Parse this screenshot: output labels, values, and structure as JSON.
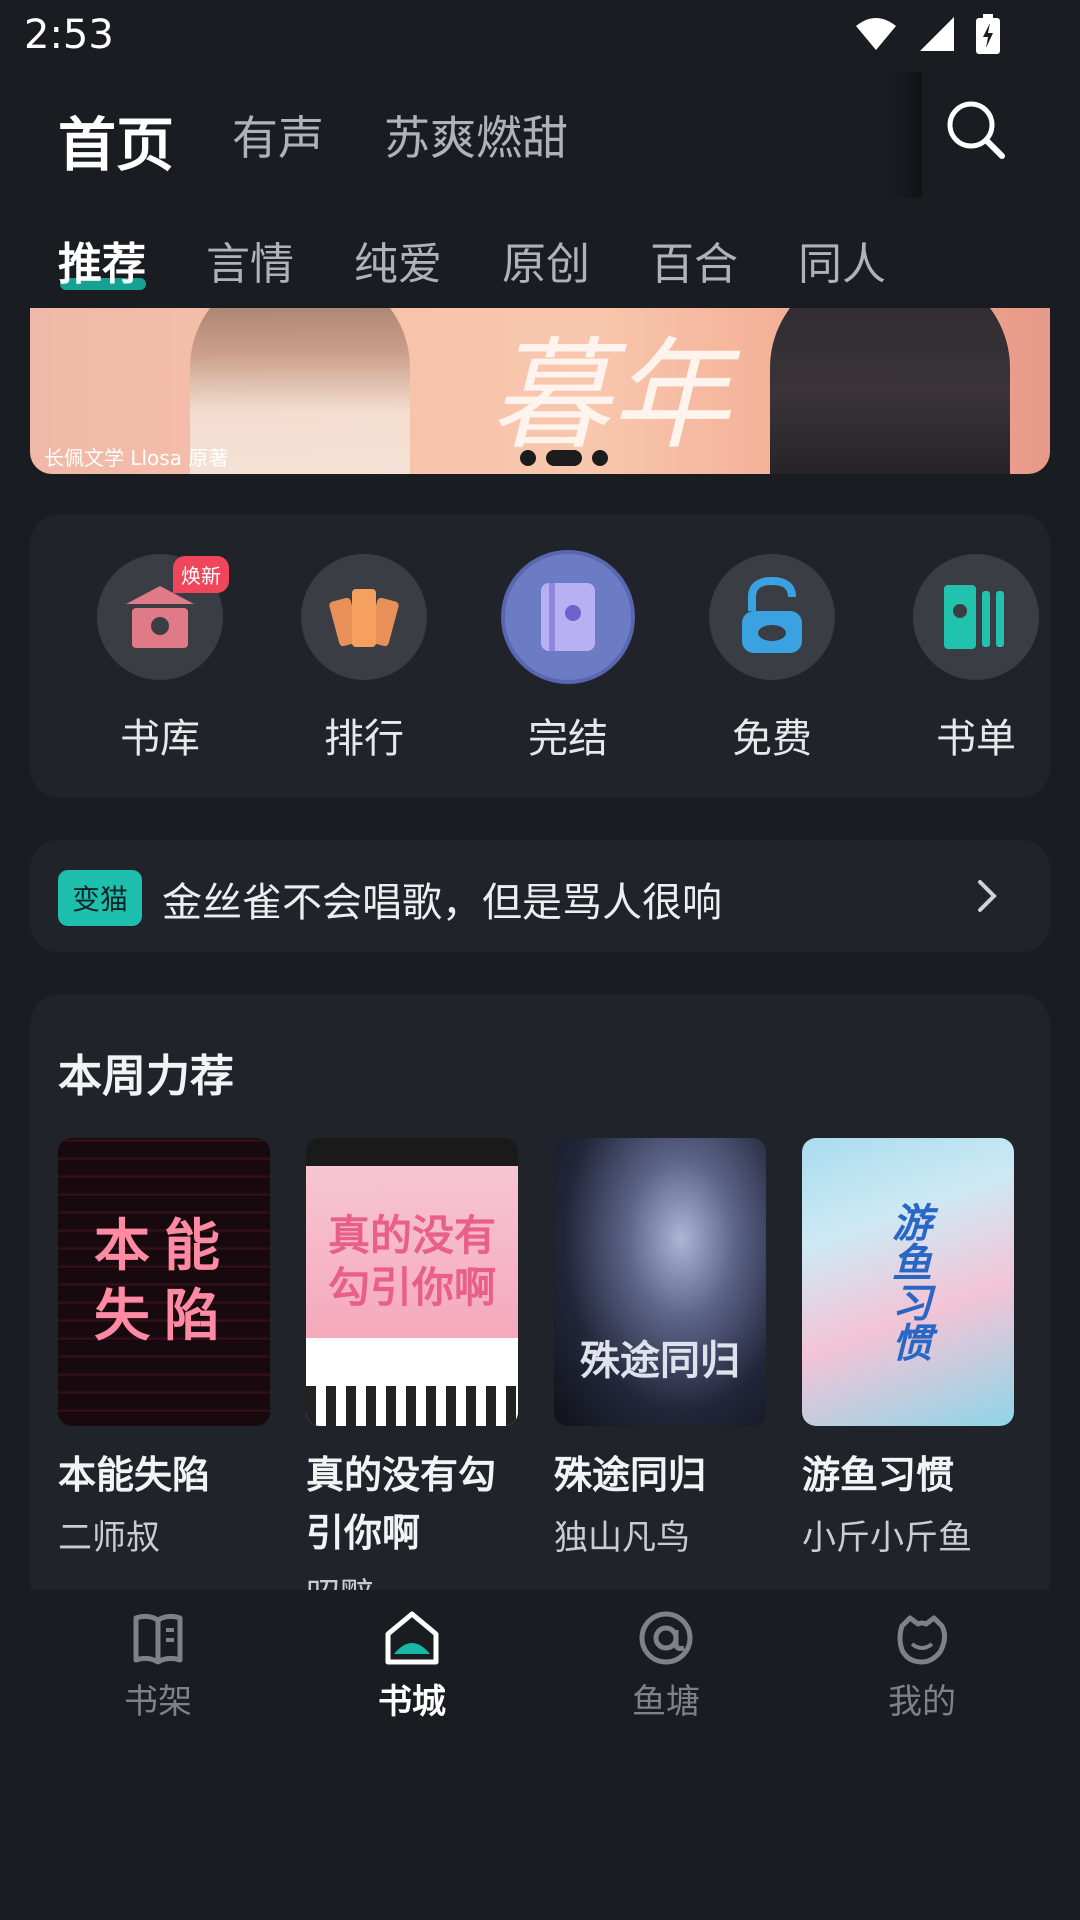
{
  "status_bar": {
    "time": "2:53"
  },
  "top_nav": {
    "tabs": [
      {
        "label": "首页",
        "active": true
      },
      {
        "label": "有声",
        "active": false
      },
      {
        "label": "苏爽燃甜",
        "active": false
      }
    ],
    "search_icon": "search-icon"
  },
  "category_tabs": [
    {
      "label": "推荐",
      "active": true
    },
    {
      "label": "言情",
      "active": false
    },
    {
      "label": "纯爱",
      "active": false
    },
    {
      "label": "原创",
      "active": false
    },
    {
      "label": "百合",
      "active": false
    },
    {
      "label": "同人",
      "active": false
    }
  ],
  "banner": {
    "credit": "长佩文学  Llosa 原著",
    "title_art": "暮年",
    "current_index": 2,
    "dot_count": 3
  },
  "quick_entries": [
    {
      "label": "书库",
      "badge": "焕新",
      "icon": "library-icon"
    },
    {
      "label": "排行",
      "icon": "ranking-icon"
    },
    {
      "label": "完结",
      "icon": "completed-book-icon"
    },
    {
      "label": "免费",
      "icon": "free-lock-icon"
    },
    {
      "label": "书单",
      "icon": "booklist-icon"
    }
  ],
  "notice": {
    "tag": "变猫",
    "text": "金丝雀不会唱歌，但是骂人很响"
  },
  "weekly": {
    "title": "本周力荐",
    "books": [
      {
        "title": "本能失陷",
        "author": "二师叔",
        "cover_text": "本能\n失陷"
      },
      {
        "title": "真的没有勾引你啊",
        "author": "昭黯",
        "cover_text": "真的没有\n勾引你啊"
      },
      {
        "title": "殊途同归",
        "author": "独山凡鸟",
        "cover_text": "殊途同归"
      },
      {
        "title": "游鱼习惯",
        "author": "小斤小斤鱼",
        "cover_text": "游鱼习惯"
      }
    ]
  },
  "bottom_nav": [
    {
      "label": "书架",
      "icon": "bookshelf-icon",
      "active": false
    },
    {
      "label": "书城",
      "icon": "bookstore-icon",
      "active": true
    },
    {
      "label": "鱼塘",
      "icon": "fishpond-icon",
      "active": false
    },
    {
      "label": "我的",
      "icon": "profile-icon",
      "active": false
    }
  ],
  "colors": {
    "background": "#191c21",
    "panel": "#20232a",
    "accent": "#17b8a6",
    "badge": "#f0465b"
  }
}
